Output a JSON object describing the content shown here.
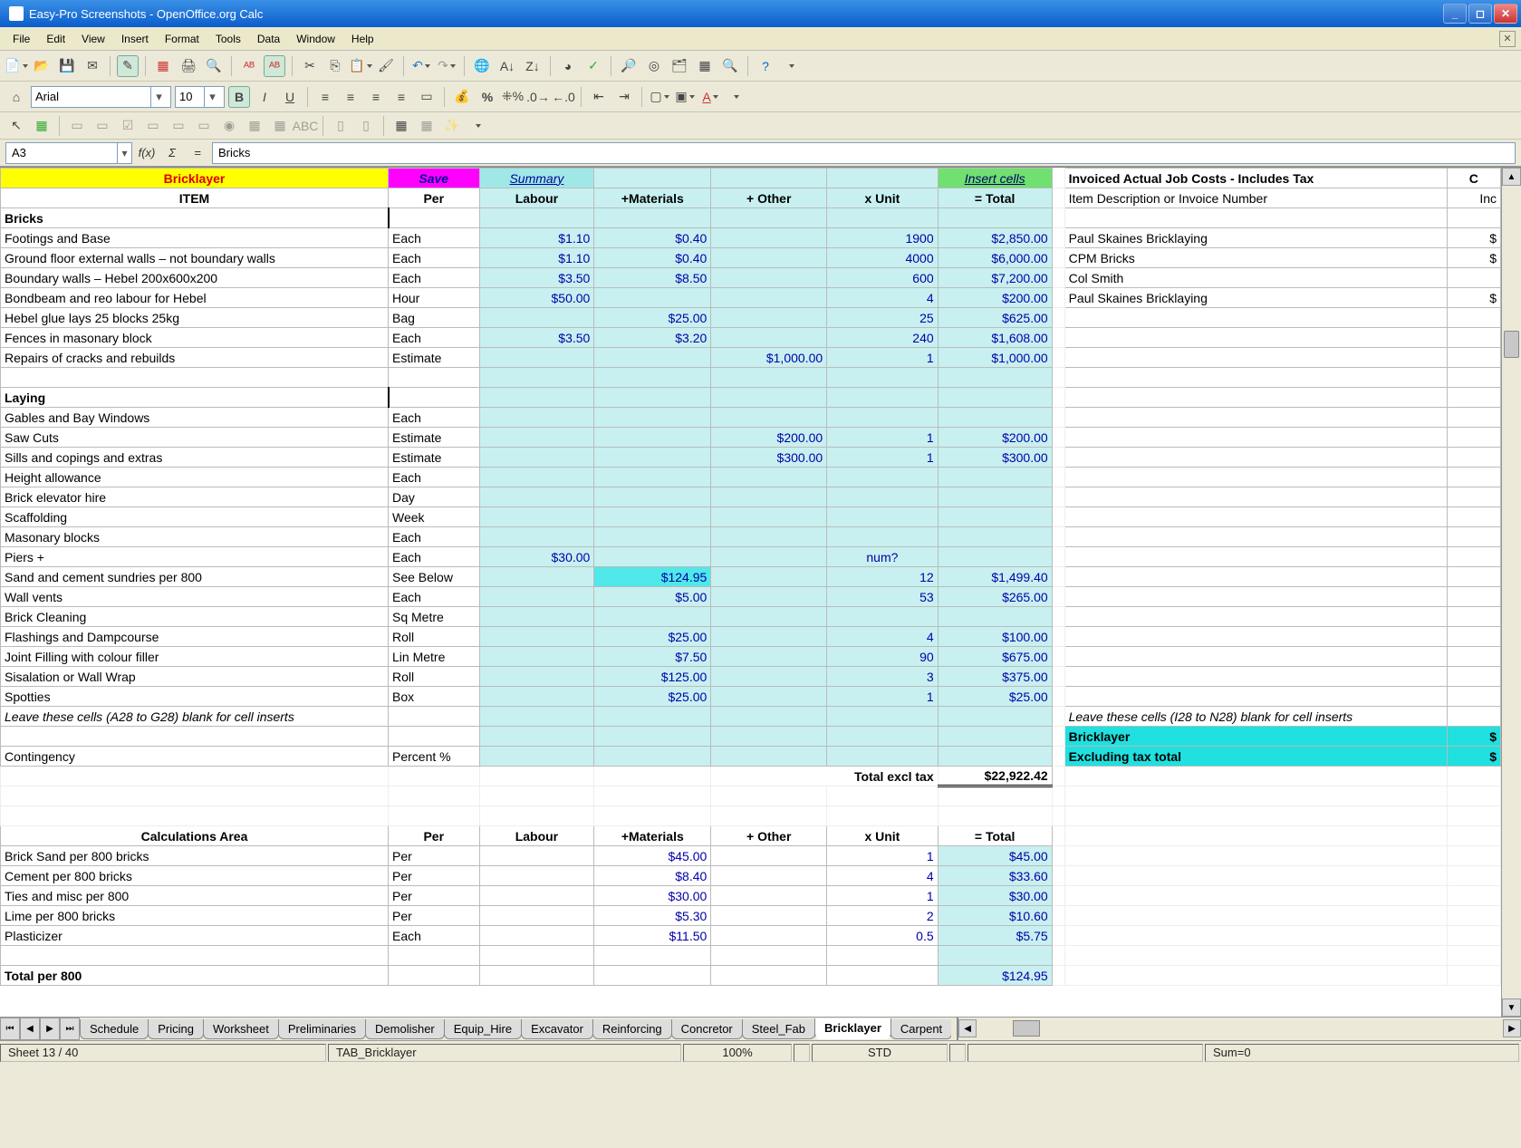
{
  "window": {
    "title": "Easy-Pro Screenshots - OpenOffice.org Calc"
  },
  "menu": [
    "File",
    "Edit",
    "View",
    "Insert",
    "Format",
    "Tools",
    "Data",
    "Window",
    "Help"
  ],
  "formula_bar": {
    "cell_ref": "A3",
    "content": "Bricks",
    "fx": "f(x)",
    "sigma": "Σ",
    "eq": "="
  },
  "format_bar": {
    "font": "Arial",
    "size": "10"
  },
  "banner": {
    "A": "Bricklayer",
    "save": "Save",
    "summary": "Summary",
    "insert_cells": "Insert cells",
    "invoiced_title": "Invoiced Actual Job Costs - Includes Tax",
    "right_cut": "C"
  },
  "col_headers": {
    "A": "ITEM",
    "B": "Per",
    "C": "Labour",
    "D": "+Materials",
    "E": "+ Other",
    "F": "x Unit",
    "G": "= Total",
    "I": "Item Description or Invoice Number",
    "J": "Inc"
  },
  "rows": [
    {
      "s": 1,
      "A": "Bricks"
    },
    {
      "A": "Footings and Base",
      "B": "Each",
      "C": "$1.10",
      "D": "$0.40",
      "F": "1900",
      "G": "$2,850.00",
      "I": "Paul Skaines Bricklaying",
      "Iend": "$"
    },
    {
      "A": "Ground floor external walls – not boundary walls",
      "B": "Each",
      "C": "$1.10",
      "D": "$0.40",
      "F": "4000",
      "G": "$6,000.00",
      "I": "CPM Bricks",
      "Iend": "$"
    },
    {
      "A": "Boundary walls  – Hebel 200x600x200",
      "B": "Each",
      "C": "$3.50",
      "D": "$8.50",
      "F": "600",
      "G": "$7,200.00",
      "I": "Col Smith"
    },
    {
      "A": "Bondbeam and reo labour for Hebel",
      "B": "Hour",
      "C": "$50.00",
      "F": "4",
      "G": "$200.00",
      "I": "Paul Skaines Bricklaying",
      "Iend": "$"
    },
    {
      "A": "Hebel glue  lays 25 blocks 25kg",
      "B": "Bag",
      "D": "$25.00",
      "F": "25",
      "G": "$625.00"
    },
    {
      "A": "Fences in masonary block",
      "B": "Each",
      "C": "$3.50",
      "D": "$3.20",
      "F": "240",
      "G": "$1,608.00"
    },
    {
      "A": "Repairs of cracks and rebuilds",
      "B": "Estimate",
      "E": "$1,000.00",
      "F": "1",
      "G": "$1,000.00"
    },
    {
      "blank": 1
    },
    {
      "s": 1,
      "A": "Laying"
    },
    {
      "A": "Gables and Bay Windows",
      "B": "Each"
    },
    {
      "A": "Saw Cuts",
      "B": "Estimate",
      "E": "$200.00",
      "F": "1",
      "G": "$200.00"
    },
    {
      "A": "Sills and copings and extras",
      "B": "Estimate",
      "E": "$300.00",
      "F": "1",
      "G": "$300.00"
    },
    {
      "A": "Height allowance",
      "B": "Each"
    },
    {
      "A": "Brick elevator hire",
      "B": "Day"
    },
    {
      "A": "Scaffolding",
      "B": "Week"
    },
    {
      "A": "Masonary blocks",
      "B": "Each"
    },
    {
      "A": "Piers +",
      "B": "Each",
      "C": "$30.00",
      "F": "num?"
    },
    {
      "A": "Sand and cement sundries per 800",
      "B": "See Below",
      "D": "$124.95",
      "Dh": 1,
      "F": "12",
      "G": "$1,499.40"
    },
    {
      "A": "Wall vents",
      "B": "Each",
      "D": "$5.00",
      "F": "53",
      "G": "$265.00"
    },
    {
      "A": "Brick Cleaning",
      "B": "Sq Metre"
    },
    {
      "A": "Flashings and Dampcourse",
      "B": "Roll",
      "D": "$25.00",
      "F": "4",
      "G": "$100.00"
    },
    {
      "A": "Joint Filling with colour filler",
      "B": "Lin Metre",
      "D": "$7.50",
      "F": "90",
      "G": "$675.00"
    },
    {
      "A": "Sisalation or Wall Wrap",
      "B": "Roll",
      "D": "$125.00",
      "F": "3",
      "G": "$375.00"
    },
    {
      "A": "Spotties",
      "B": "Box",
      "D": "$25.00",
      "F": "1",
      "G": "$25.00"
    },
    {
      "it": 1,
      "A": "Leave these cells (A28 to G28) blank for cell inserts",
      "I": "Leave these cells (I28 to N28) blank for cell inserts",
      "Iit": 1
    },
    {
      "blank": 1,
      "Ihl": "Bricklayer",
      "Ihlend": "$"
    },
    {
      "A": "Contingency",
      "B": "Percent %",
      "Ihl": "Excluding tax total",
      "Ihlend": "$"
    },
    {
      "tot": 1,
      "E": "Total excl tax",
      "G": "$22,922.42"
    }
  ],
  "calc_hdr": {
    "A": "Calculations Area",
    "B": "Per",
    "C": "Labour",
    "D": "+Materials",
    "E": "+ Other",
    "F": "x Unit",
    "G": "= Total"
  },
  "calc_rows": [
    {
      "A": "Brick Sand per 800 bricks",
      "B": "Per",
      "D": "$45.00",
      "F": "1",
      "G": "$45.00"
    },
    {
      "A": "Cement per 800 bricks",
      "B": "Per",
      "D": "$8.40",
      "F": "4",
      "G": "$33.60"
    },
    {
      "A": "Ties and misc per 800",
      "B": "Per",
      "D": "$30.00",
      "F": "1",
      "G": "$30.00"
    },
    {
      "A": "Lime per 800 bricks",
      "B": "Per",
      "D": "$5.30",
      "F": "2",
      "G": "$10.60"
    },
    {
      "A": "Plasticizer",
      "B": "Each",
      "D": "$11.50",
      "F": "0.5",
      "G": "$5.75"
    },
    {
      "blank": 1
    },
    {
      "A": "Total per 800",
      "G": "$124.95",
      "partial": 1
    }
  ],
  "tabs": [
    "Schedule",
    "Pricing",
    "Worksheet",
    "Preliminaries",
    "Demolisher",
    "Equip_Hire",
    "Excavator",
    "Reinforcing",
    "Concretor",
    "Steel_Fab",
    "Bricklayer",
    "Carpent"
  ],
  "active_tab": "Bricklayer",
  "status": {
    "sheet": "Sheet 13 / 40",
    "tab": "TAB_Bricklayer",
    "zoom": "100%",
    "mode": "STD",
    "sum": "Sum=0"
  }
}
